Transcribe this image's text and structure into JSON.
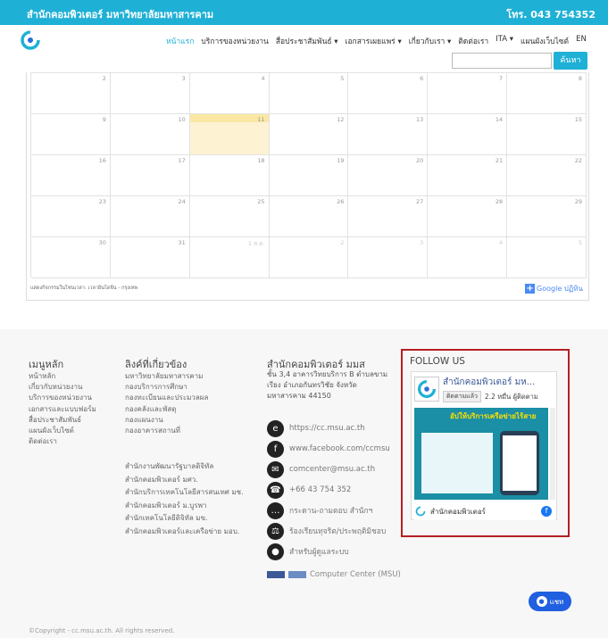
{
  "topbar": {
    "org": "สำนักคอมพิวเตอร์ มหาวิทยาลัยมหาสารคาม",
    "phone": "โทร. 043 754352"
  },
  "nav": {
    "items": [
      "หน้าแรก",
      "บริการของหน่วยงาน",
      "สื่อประชาสัมพันธ์ ▾",
      "เอกสารเผยแพร่ ▾",
      "เกี่ยวกับเรา ▾",
      "ติดต่อเรา",
      "ITA ▾",
      "แผนผังเว็บไซต์",
      "EN"
    ],
    "search_button": "ค้นหา",
    "search_value": ""
  },
  "calendar": {
    "weeks": [
      [
        "2",
        "3",
        "4",
        "5",
        "6",
        "7",
        "8"
      ],
      [
        "9",
        "10",
        "11",
        "12",
        "13",
        "14",
        "15"
      ],
      [
        "16",
        "17",
        "18",
        "19",
        "20",
        "21",
        "22"
      ],
      [
        "23",
        "24",
        "25",
        "26",
        "27",
        "28",
        "29"
      ],
      [
        "30",
        "31",
        "1 ส.ค.",
        "2",
        "3",
        "4",
        "5"
      ]
    ],
    "today": "11",
    "timezone_note": "แสดงกิจกรรมในโซนเวลา: เวลาอินโดจีน - กรุงเทพ",
    "gcal_button": "Google ปฏิทิน",
    "gcal_plus": "+"
  },
  "footer": {
    "menu": {
      "title": "เมนูหลัก",
      "items": [
        "หน้าหลัก",
        "เกี่ยวกับหน่วยงาน",
        "บริการของหน่วยงาน",
        "เอกสารและแบบฟอร์ม",
        "สื่อประชาสัมพันธ์",
        "แผนผังเว็บไซต์",
        "ติดต่อเรา"
      ]
    },
    "links": {
      "title": "ลิงค์ที่เกี่ยวข้อง",
      "items": [
        "มหาวิทยาลัยมหาสารคาม",
        "กองบริการการศึกษา",
        "กองทะเบียนและประมวลผล",
        "กองคลังและพัสดุ",
        "กองแผนงาน",
        "กองอาคารสถานที่"
      ],
      "items2": [
        "สำนักงานพัฒนารัฐบาลดิจิทัล",
        "สำนักคอมพิวเตอร์ มศว.",
        "สำนักบริการเทคโนโลยีสารสนเทศ มช.",
        "สำนักคอมพิวเตอร์ ม.บูรพา",
        "สำนักเทคโนโลยีดิจิทัล มข.",
        "สำนักคอมพิวเตอร์และเครือข่าย มอบ."
      ]
    },
    "office": {
      "title": "สำนักคอมพิวเตอร์ มมส",
      "address": [
        "ชั้น 3,4 อาคารวิทยบริการ B ตำบลขาม",
        "เรียง อำเภอกันทรวิชัย จังหวัด",
        "มหาสารคาม 44150"
      ],
      "contacts": [
        {
          "icon": "ie-icon",
          "glyph": "e",
          "text": "https://cc.msu.ac.th"
        },
        {
          "icon": "facebook-icon",
          "glyph": "f",
          "text": "www.facebook.com/ccmsu"
        },
        {
          "icon": "email-icon",
          "glyph": "✉",
          "text": "comcenter@msu.ac.th"
        },
        {
          "icon": "phone-icon",
          "glyph": "☎",
          "text": "+66 43 754 352"
        },
        {
          "icon": "chat-icon",
          "glyph": "…",
          "text": "กระดาน-ถามตอบ สำนักฯ"
        },
        {
          "icon": "scale-icon",
          "glyph": "⚖",
          "text": "ร้องเรียนทุจริต/ประพฤติมิชอบ"
        },
        {
          "icon": "user-icon",
          "glyph": "●",
          "text": "สำหรับผู้ดูแลระบบ"
        }
      ],
      "badge_text": "Computer Center (MSU)"
    },
    "follow": {
      "title": "FOLLOW US",
      "page_name": "สำนักคอมพิวเตอร์ มห...",
      "follow_button": "ติดตามแล้ว",
      "followers": "2.2 หมื่น ผู้ติดตาม",
      "banner_title": "อัปให้บริการเครือข่ายไร้สาย",
      "post_name": "สำนักคอมพิวเตอร์",
      "fb_glyph": "f"
    },
    "chat_button": "แชท",
    "chat_glyph": "●",
    "copyright": "©Copyright - cc.msu.ac.th. All rights reserved."
  },
  "colors": {
    "brand": "#1fb0d6",
    "highlight": "#b51f24",
    "today": "#fdf3d3",
    "chat": "#1f5fe0"
  }
}
